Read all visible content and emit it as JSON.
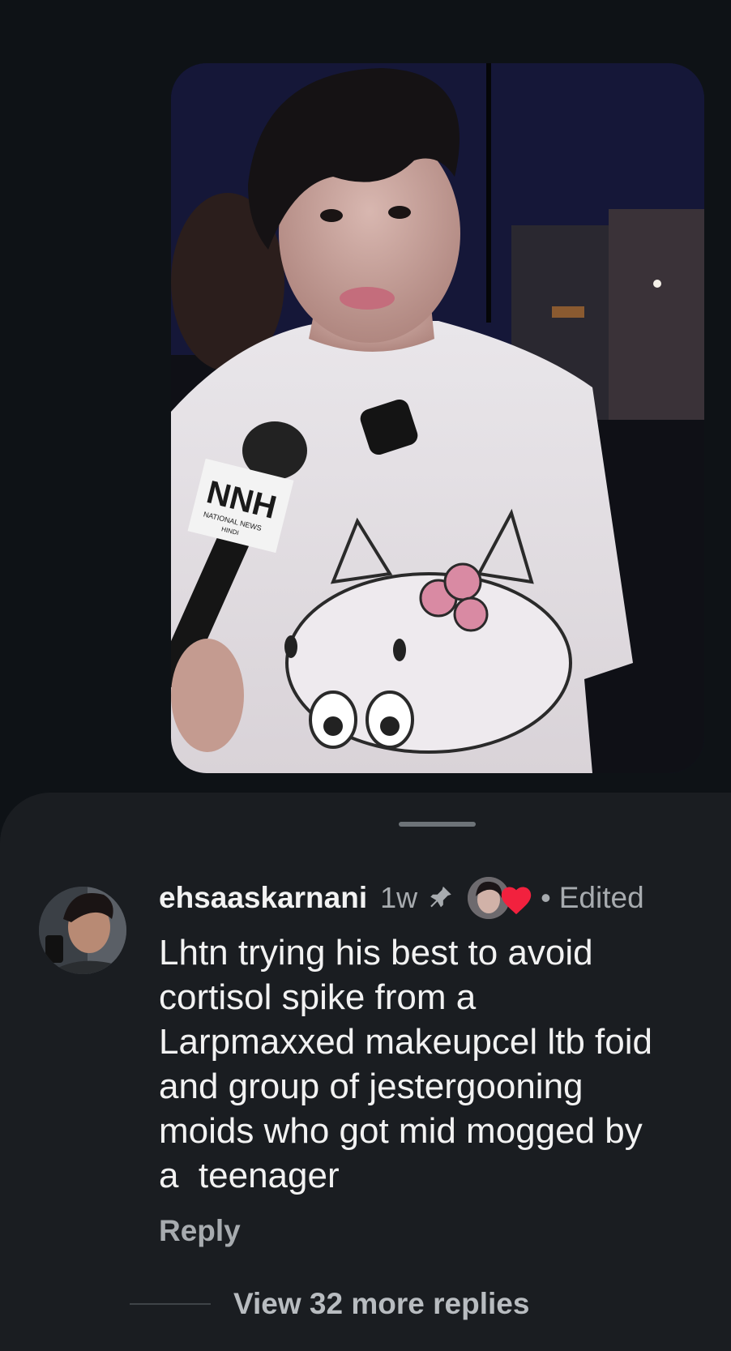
{
  "media": {
    "mic_brand": "NNH",
    "mic_brand_sub": "NATIONAL NEWS",
    "mic_brand_sub2": "HINDI"
  },
  "comment": {
    "username": "ehsaaskarnani",
    "time": "1w",
    "edited_dot": "•",
    "edited_label": "Edited",
    "text": "Lhtn trying his best to avoid\ncortisol spike from a\nLarpmaxxed makeupcel ltb foid\nand group of jestergooning\nmoids who got mid mogged by\na  teenager",
    "reply_label": "Reply",
    "view_replies_label": "View 32 more replies"
  },
  "colors": {
    "background": "#0e1216",
    "sheet": "#1a1d21",
    "text_primary": "#f2f2f2",
    "text_secondary": "#a7abaf",
    "heart": "#f2213e"
  },
  "icons": {
    "pin": "pin-icon",
    "heart": "heart-icon"
  }
}
